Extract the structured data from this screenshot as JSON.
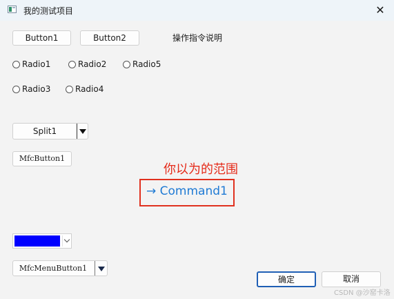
{
  "window": {
    "title": "我的测试项目",
    "close_glyph": "✕"
  },
  "buttons": {
    "button1": "Button1",
    "button2": "Button2",
    "split": "Split1",
    "mfc_button": "MfcButton1",
    "mfc_menu_button": "MfcMenuButton1",
    "ok": "确定",
    "cancel": "取消"
  },
  "static_text": "操作指令说明",
  "radios": [
    {
      "label": "Radio1",
      "checked": false
    },
    {
      "label": "Radio2",
      "checked": false
    },
    {
      "label": "Radio5",
      "checked": false
    },
    {
      "label": "Radio3",
      "checked": false
    },
    {
      "label": "Radio4",
      "checked": false
    }
  ],
  "color_picker": {
    "color": "#0000ff"
  },
  "annotation": {
    "text": "你以为的范围",
    "color": "#e52b1a"
  },
  "command_link": {
    "arrow": "→",
    "label": "Command1",
    "color": "#1f7ad4"
  },
  "watermark": "CSDN @沙窑卡洛"
}
